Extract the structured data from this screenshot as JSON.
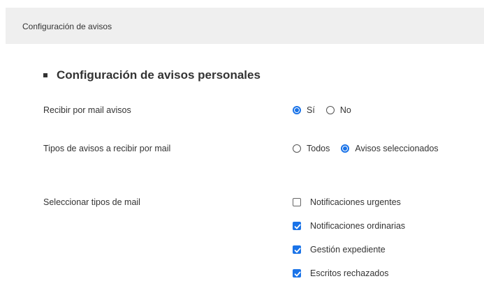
{
  "header": {
    "title": "Configuración de avisos"
  },
  "section": {
    "title": "Configuración de avisos personales"
  },
  "receive_mail": {
    "label": "Recibir por mail avisos",
    "options": [
      {
        "label": "Sí",
        "checked": true
      },
      {
        "label": "No",
        "checked": false
      }
    ]
  },
  "notice_types": {
    "label": "Tipos de avisos a recibir por mail",
    "options": [
      {
        "label": "Todos",
        "checked": false
      },
      {
        "label": "Avisos seleccionados",
        "checked": true
      }
    ]
  },
  "mail_types": {
    "label": "Seleccionar tipos de mail",
    "items": [
      {
        "label": "Notificaciones urgentes",
        "checked": false
      },
      {
        "label": "Notificaciones ordinarias",
        "checked": true
      },
      {
        "label": "Gestión expediente",
        "checked": true
      },
      {
        "label": "Escritos rechazados",
        "checked": true
      }
    ]
  },
  "colors": {
    "accent": "#1a73e8",
    "header_bg": "#efefef",
    "text": "#333333"
  }
}
